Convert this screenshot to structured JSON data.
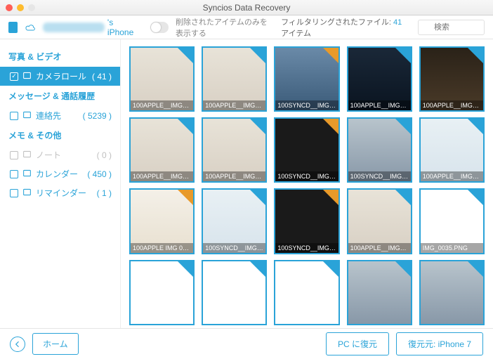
{
  "titlebar": {
    "title": "Syncios Data Recovery"
  },
  "toolbar": {
    "device_suffix": "'s iPhone",
    "show_deleted_label": "削除されたアイテムのみを表示する",
    "filter_label": "フィルタリングされたファイル: ",
    "filter_count": "41",
    "filter_unit": " アイテム",
    "search_placeholder": "検索"
  },
  "sidebar": {
    "sections": [
      {
        "title": "写真 & ビデオ",
        "items": [
          {
            "label": "カメラロール",
            "count": "( 41 )",
            "checked": true,
            "selected": true,
            "disabled": false
          }
        ]
      },
      {
        "title": "メッセージ & 通話履歴",
        "items": [
          {
            "label": "連絡先",
            "count": "( 5239 )",
            "checked": false,
            "selected": false,
            "disabled": false
          }
        ]
      },
      {
        "title": "メモ & その他",
        "items": [
          {
            "label": "ノート",
            "count": "( 0 )",
            "checked": false,
            "selected": false,
            "disabled": true
          },
          {
            "label": "カレンダー",
            "count": "( 450 )",
            "checked": false,
            "selected": false,
            "disabled": false
          },
          {
            "label": "リマインダー",
            "count": "( 1 )",
            "checked": false,
            "selected": false,
            "disabled": false
          }
        ]
      }
    ]
  },
  "grid": {
    "items": [
      {
        "caption": "100APPLE__IMG_0…",
        "badge": "blue",
        "bg": "thumb-bg1"
      },
      {
        "caption": "100APPLE__IMG_0…",
        "badge": "blue",
        "bg": "thumb-bg1"
      },
      {
        "caption": "100SYNCD__IMG_…",
        "badge": "orange",
        "bg": "thumb-bg2"
      },
      {
        "caption": "100APPLE__IMG_0…",
        "badge": "blue",
        "bg": "thumb-bg3"
      },
      {
        "caption": "100APPLE__IMG_0…",
        "badge": "blue",
        "bg": "thumb-bg4"
      },
      {
        "caption": "100APPLE__IMG_0…",
        "badge": "blue",
        "bg": "thumb-bg1"
      },
      {
        "caption": "100APPLE__IMG_0…",
        "badge": "blue",
        "bg": "thumb-bg1"
      },
      {
        "caption": "100SYNCD__IMG_0…",
        "badge": "orange",
        "bg": "thumb-bgdark"
      },
      {
        "caption": "100SYNCD__IMG_IP…",
        "badge": "blue",
        "bg": "thumb-bg5"
      },
      {
        "caption": "100APPLE__IMG_0…",
        "badge": "blue",
        "bg": "thumb-bg6"
      },
      {
        "caption": "100APPLE IMG 0…",
        "badge": "orange",
        "bg": "thumb-bg8"
      },
      {
        "caption": "100SYNCD__IMG_…",
        "badge": "blue",
        "bg": "thumb-bg6"
      },
      {
        "caption": "100SYNCD__IMG_…",
        "badge": "orange",
        "bg": "thumb-bgdark"
      },
      {
        "caption": "100APPLE__IMG_0…",
        "badge": "blue",
        "bg": "thumb-bg1"
      },
      {
        "caption": "IMG_0035.PNG",
        "badge": "blue",
        "bg": "thumb-bg7"
      },
      {
        "caption": "",
        "badge": "blue",
        "bg": "thumb-bg7",
        "no_caption": true
      },
      {
        "caption": "",
        "badge": "blue",
        "bg": "thumb-bg7",
        "no_caption": true
      },
      {
        "caption": "",
        "badge": "blue",
        "bg": "thumb-bg7",
        "no_caption": true
      },
      {
        "caption": "",
        "badge": "blue",
        "bg": "thumb-bg5",
        "no_caption": true
      },
      {
        "caption": "",
        "badge": "blue",
        "bg": "thumb-bg5",
        "no_caption": true
      }
    ]
  },
  "footer": {
    "home": "ホーム",
    "recover_pc": "PC に復元",
    "recover_device": "復元元: iPhone 7"
  }
}
